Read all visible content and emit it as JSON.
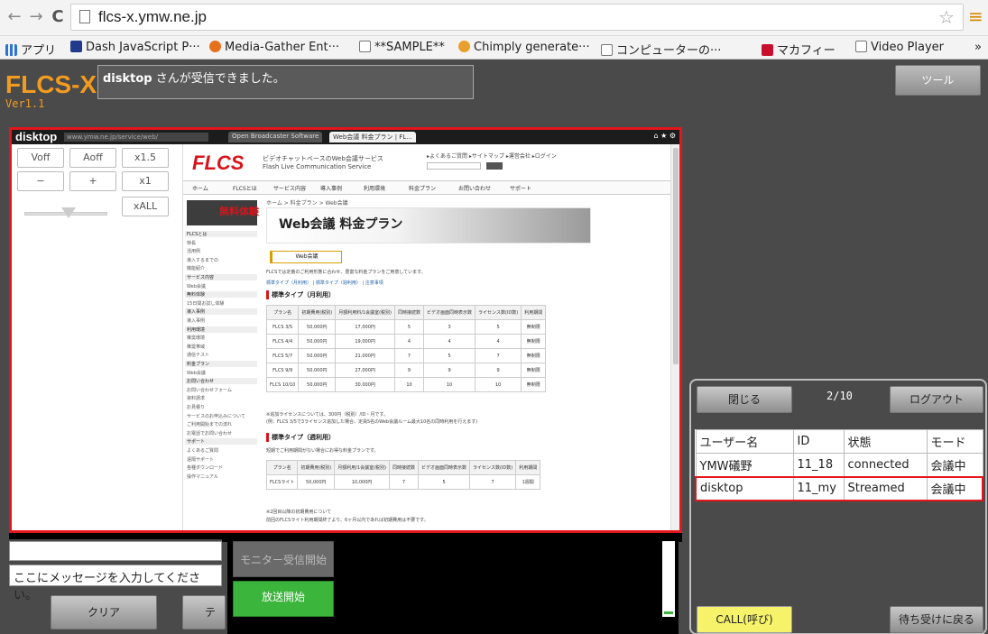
{
  "browser": {
    "url": "flcs-x.ymw.ne.jp",
    "bookmarks": [
      {
        "label": "アプリ",
        "icon": "apps-grid-icon",
        "color": "#2c73d2"
      },
      {
        "label": "Dash JavaScript P···",
        "icon": "dash-icon",
        "color": "#223a8c"
      },
      {
        "label": "Media-Gather Ent···",
        "icon": "media-gather-icon",
        "color": "#e7701c"
      },
      {
        "label": "**SAMPLE**",
        "icon": "page-icon",
        "color": "#ffffff"
      },
      {
        "label": "Chimply generate···",
        "icon": "chimply-icon",
        "color": "#e8a02c"
      },
      {
        "label": "コンピューターの···",
        "icon": "page-icon",
        "color": "#ffffff"
      },
      {
        "label": "マカフィー",
        "icon": "mcafee-icon",
        "color": "#c8102e"
      },
      {
        "label": "Video Player",
        "icon": "page-icon",
        "color": "#ffffff"
      }
    ],
    "more": "»"
  },
  "app": {
    "logo": "FLCS-X",
    "version": "Ver1.1",
    "notice_user": "disktop",
    "notice_text": " さんが受信できました。",
    "tool_label": "ツール"
  },
  "stream": {
    "inner_logo": "disktop",
    "inner_url": "www.ymw.ne.jp/service/web/",
    "tabs": [
      "Open Broadcaster Software",
      "Web会議 料金プラン | FL..."
    ],
    "controls": {
      "voff": "Voff",
      "aoff": "Aoff",
      "x15": "x1.5",
      "minus": "−",
      "plus": "+",
      "x1": "x1",
      "xall": "xALL"
    },
    "webpage": {
      "logo": "FLCS",
      "subtitle_1": "ビデオチャットベースのWeb会議サービス",
      "subtitle_2": "Flash Live Communication Service",
      "top_links": "▸よくあるご質問  ▸サイトマップ  ▸運営会社  ▸ログイン",
      "nav": [
        "ホーム",
        "FLCSとは",
        "サービス内容",
        "導入事例",
        "利用環境",
        "料金プラン",
        "お問い合わせ",
        "サポート"
      ],
      "breadcrumb": "ホーム > 料金プラン > Web会議",
      "hero_title": "Web会議 料金プラン",
      "tab_label": "Web会議",
      "intro": "FLCSでは定番のご利用形態に合わせ、豊富な料金プランをご用意しています。",
      "links": "標準タイプ（月利用） | 標準タイプ（週利用） | 注意事項",
      "section1": "標準タイプ（月利用）",
      "headers": [
        "プラン名",
        "初期費用(税別)",
        "月額利用料/1会議室(税別)",
        "同時接続数",
        "ビデオ画面同時表示数",
        "ライセンス数(ID数)",
        "利用期間"
      ],
      "rows": [
        [
          "FLCS 3/5",
          "50,000円",
          "17,000円",
          "5",
          "3",
          "5",
          "無制限"
        ],
        [
          "FLCS 4/4",
          "50,000円",
          "19,000円",
          "4",
          "4",
          "4",
          "無制限"
        ],
        [
          "FLCS 5/7",
          "50,000円",
          "21,000円",
          "7",
          "5",
          "7",
          "無制限"
        ],
        [
          "FLCS 9/9",
          "50,000円",
          "27,000円",
          "9",
          "9",
          "9",
          "無制限"
        ],
        [
          "FLCS 10/10",
          "50,000円",
          "30,000円",
          "10",
          "10",
          "10",
          "無制限"
        ]
      ],
      "note1": "※追加ライセンスについては、300円（税別）/ID・月です。",
      "note2": "(例：FLCS 3/5で3ライセンス追加した場合、定員5名のWeb会議ルーム最大10名の同時利用を行えます)",
      "section2": "標準タイプ（週利用）",
      "intro2": "短期でご利用期間がない場合にお得な料金プランです。",
      "headers2": [
        "プラン名",
        "初期費用(税別)",
        "月額利用/1会議室(税別)",
        "同時接続数",
        "ビデオ画面同時表示数",
        "ライセンス数(ID数)",
        "利用期間"
      ],
      "rows2": [
        [
          "FLCSライト",
          "50,000円",
          "10,000円",
          "7",
          "5",
          "7",
          "1週間"
        ]
      ],
      "note3": "※2回目以降の初期費用について",
      "note4": "前回のFLCSライト利用期間終了より、6ヶ月以内であれば初期費用は不要です。",
      "side_items": [
        "FLCSとは",
        "特長",
        "活用例",
        "導入するまでの",
        "機能紹介",
        "サービス内容",
        "Web会議",
        "無料体験",
        "15日間お試し体験",
        "導入事例",
        "導入事例",
        "利用環境",
        "推奨環境",
        "推奨帯域",
        "通信テスト",
        "料金プラン",
        "Web会議",
        "お問い合わせ",
        "お問い合わせフォーム",
        "資料請求",
        "お見積り",
        "サービスのお申込みについて",
        "ご利用開始までの流れ",
        "お電話でお問い合わせ",
        "サポート",
        "よくあるご質問",
        "遠隔サポート",
        "各種ダウンロード",
        "操作マニュアル"
      ],
      "banner_text": "無料体験"
    }
  },
  "bottom": {
    "message_placeholder": "ここにメッセージを入力してください。",
    "clear_label": "クリア",
    "text_label": "テキ",
    "monitor_label": "モニター受信開始",
    "broadcast_label": "放送開始"
  },
  "right_panel": {
    "close_label": "閉じる",
    "count": "2/10",
    "logout_label": "ログアウト",
    "columns": [
      "ユーザー名",
      "ID",
      "状態",
      "モード"
    ],
    "users": [
      [
        "YMW礒野",
        "11_18",
        "connected",
        "会議中"
      ],
      [
        "disktop",
        "11_my",
        "Streamed",
        "会議中"
      ]
    ],
    "call_label": "CALL(呼び)",
    "wait_label": "待ち受けに戻る"
  },
  "colors": {
    "accent_orange": "#f29b21",
    "highlight_red": "#e3161b",
    "broadcast_green": "#3cb53c",
    "call_yellow": "#f6f36b"
  }
}
